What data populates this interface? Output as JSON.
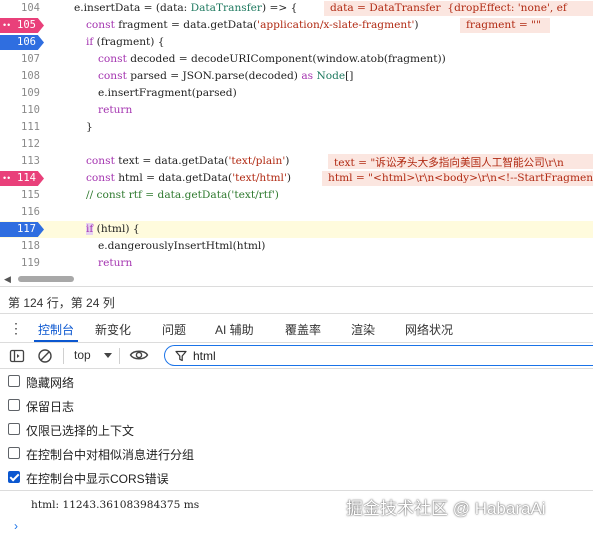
{
  "editor": {
    "lines": [
      {
        "number": "104",
        "bp": "none"
      },
      {
        "number": "105",
        "bp": "pink"
      },
      {
        "number": "106",
        "bp": "blue"
      },
      {
        "number": "107",
        "bp": "none"
      },
      {
        "number": "108",
        "bp": "none"
      },
      {
        "number": "109",
        "bp": "none"
      },
      {
        "number": "110",
        "bp": "none"
      },
      {
        "number": "111",
        "bp": "none"
      },
      {
        "number": "112",
        "bp": "none"
      },
      {
        "number": "113",
        "bp": "none"
      },
      {
        "number": "114",
        "bp": "pink"
      },
      {
        "number": "115",
        "bp": "none"
      },
      {
        "number": "116",
        "bp": "none"
      },
      {
        "number": "117",
        "bp": "blue"
      },
      {
        "number": "118",
        "bp": "none"
      },
      {
        "number": "119",
        "bp": "none"
      }
    ],
    "inline_values": {
      "l104": "data = DataTransfer  {dropEffect: 'none', ef",
      "l105": "fragment = \"\"",
      "l113": "text = \"诉讼矛头大多指向美国人工智能公司\\r\\n",
      "l114": "html = \"<html>\\r\\n<body>\\r\\n<!--StartFragmen"
    }
  },
  "status": {
    "cursor_position": "第 124 行，第 24 列"
  },
  "drawer": {
    "tabs": [
      "控制台",
      "新变化",
      "问题",
      "AI 辅助",
      "覆盖率",
      "渲染",
      "网络状况"
    ],
    "active_tab": "控制台"
  },
  "toolbar": {
    "context": "top",
    "filter_value": "html"
  },
  "settings": [
    {
      "label": "隐藏网络",
      "checked": false
    },
    {
      "label": "保留日志",
      "checked": false
    },
    {
      "label": "仅限已选择的上下文",
      "checked": false
    },
    {
      "label": "在控制台中对相似消息进行分组",
      "checked": false
    },
    {
      "label": "在控制台中显示CORS错误",
      "checked": true
    }
  ],
  "console": {
    "log": "html: 11243.361083984375 ms",
    "watermark": "掘金技术社区 @ HabaraAi"
  },
  "colors": {
    "accent": "#0b57d0",
    "breakpoint_pink": "#e9407a",
    "breakpoint_blue": "#2f6ee0",
    "inline_value_bg": "#fbe6e0"
  }
}
